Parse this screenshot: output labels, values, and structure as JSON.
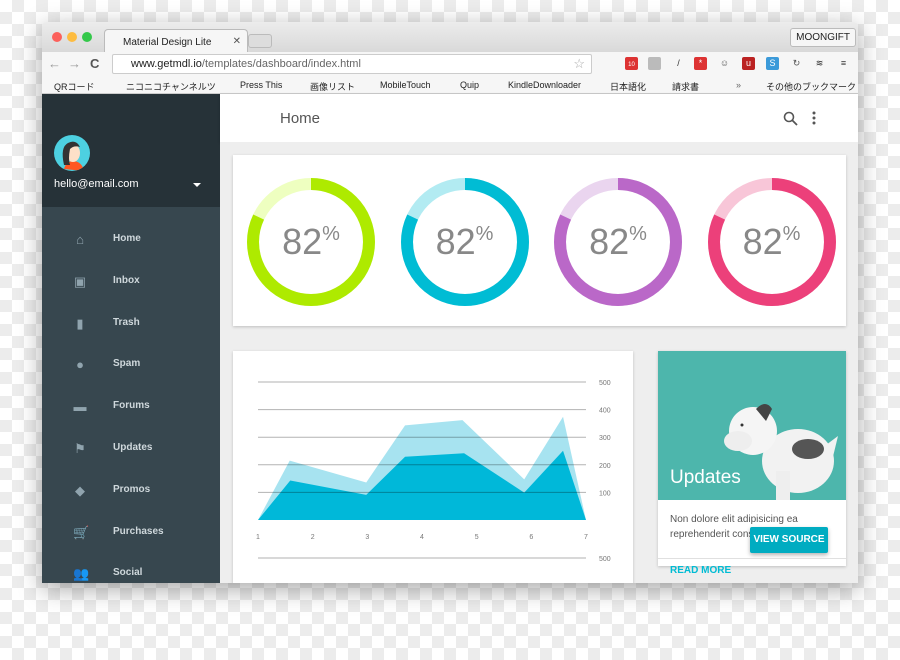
{
  "browser": {
    "tab_title": "Material Design Lite",
    "profile": "MOONGIFT",
    "url_host": "www.getmdl.io",
    "url_path": "/templates/dashboard/index.html",
    "bookmarks": [
      "QRコード",
      "ニコニコチャンネルツ",
      "Press This",
      "画像リスト",
      "MobileTouch",
      "Quip",
      "KindleDownloader",
      "日本語化",
      "請求書",
      "その他のブックマーク"
    ],
    "badge_count": "10"
  },
  "sidebar": {
    "email": "hello@email.com",
    "items": [
      {
        "label": "Home",
        "icon": "home-icon",
        "glyph": "⌂"
      },
      {
        "label": "Inbox",
        "icon": "inbox-icon",
        "glyph": "▣"
      },
      {
        "label": "Trash",
        "icon": "trash-icon",
        "glyph": "▮"
      },
      {
        "label": "Spam",
        "icon": "report-icon",
        "glyph": "●"
      },
      {
        "label": "Forums",
        "icon": "forum-icon",
        "glyph": "▬"
      },
      {
        "label": "Updates",
        "icon": "flag-icon",
        "glyph": "⚑"
      },
      {
        "label": "Promos",
        "icon": "tag-icon",
        "glyph": "◆"
      },
      {
        "label": "Purchases",
        "icon": "cart-icon",
        "glyph": "🛒"
      },
      {
        "label": "Social",
        "icon": "people-icon",
        "glyph": "👥"
      }
    ]
  },
  "header": {
    "title": "Home"
  },
  "donuts": [
    {
      "value": "82",
      "unit": "%",
      "color": "#aeea00",
      "track": "#eeffc0",
      "fraction": 0.82
    },
    {
      "value": "82",
      "unit": "%",
      "color": "#00bcd4",
      "track": "#b2ebf2",
      "fraction": 0.82
    },
    {
      "value": "82",
      "unit": "%",
      "color": "#ba68c8",
      "track": "#ead5ef",
      "fraction": 0.82
    },
    {
      "value": "82",
      "unit": "%",
      "color": "#ec407a",
      "track": "#f8c6d8",
      "fraction": 0.82
    }
  ],
  "chart_data": {
    "type": "area",
    "xlim": [
      1,
      7
    ],
    "ylim": [
      0,
      500
    ],
    "grid": true,
    "x_ticks": [
      "1",
      "2",
      "3",
      "4",
      "5",
      "6",
      "7"
    ],
    "y_ticks": [
      "100",
      "200",
      "300",
      "400",
      "500"
    ],
    "extra_tick": "500",
    "series": [
      {
        "color": "#a7e3f0",
        "points": [
          [
            1,
            0
          ],
          [
            1.58,
            215
          ],
          [
            2.98,
            136
          ],
          [
            3.69,
            343
          ],
          [
            4.74,
            362
          ],
          [
            5.87,
            147
          ],
          [
            6.58,
            374
          ],
          [
            7,
            0
          ]
        ]
      },
      {
        "color": "#00b8d9",
        "points": [
          [
            1,
            0
          ],
          [
            1.59,
            143
          ],
          [
            2.98,
            91
          ],
          [
            3.69,
            229
          ],
          [
            4.77,
            242
          ],
          [
            5.87,
            99
          ],
          [
            6.58,
            251
          ],
          [
            7,
            0
          ]
        ]
      }
    ]
  },
  "updates_card": {
    "title": "Updates",
    "text": "Non dolore elit adipisicing ea reprehenderit cons",
    "view_source": "VIEW SOURCE",
    "read_more": "READ MORE",
    "bg": "#4db6ac"
  }
}
